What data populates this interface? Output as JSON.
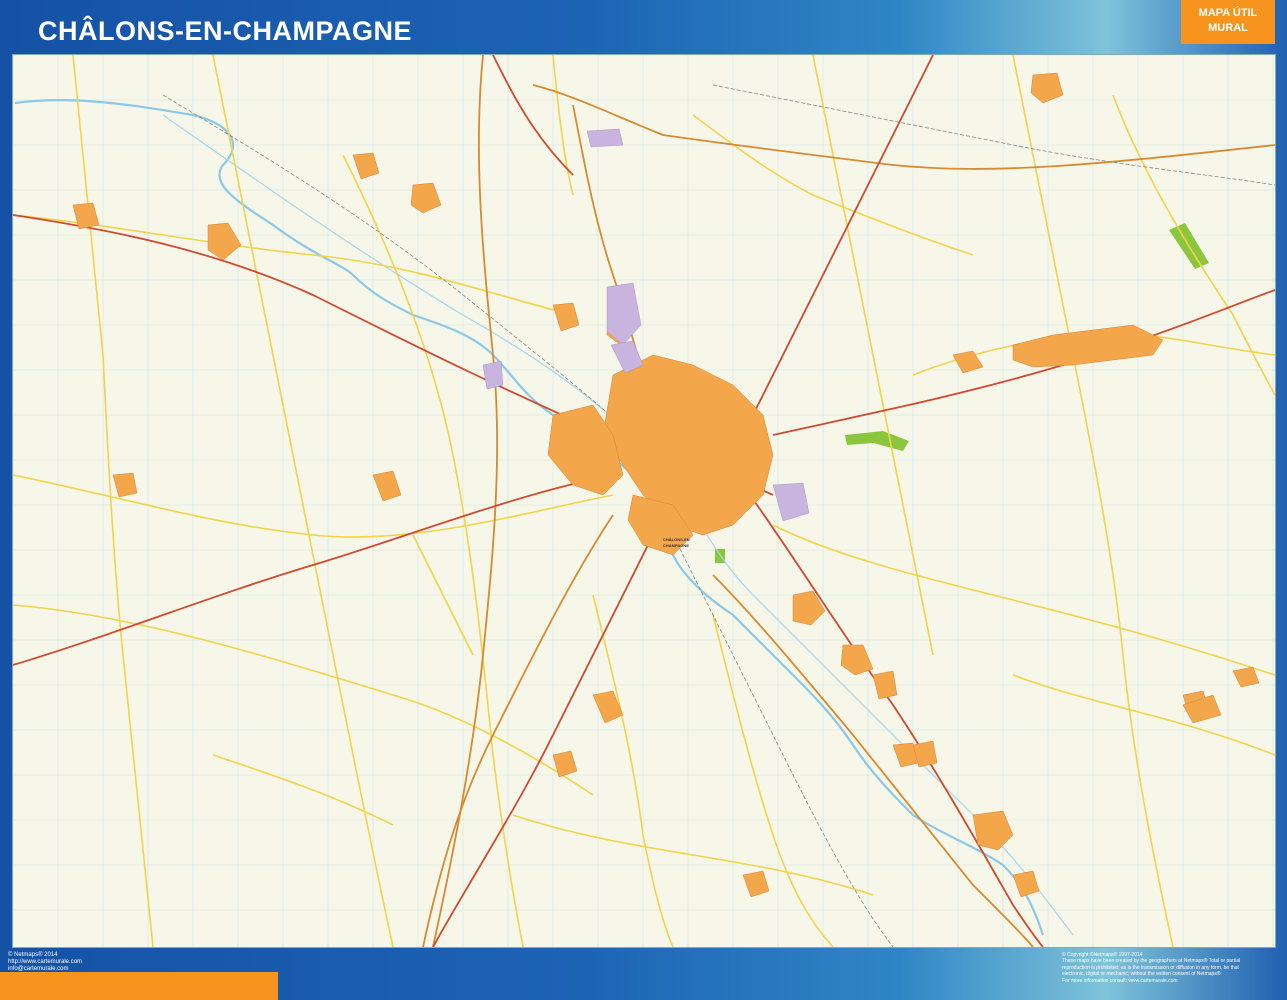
{
  "header": {
    "title": "CHÂLONS-EN-CHAMPAGNE",
    "badge_line1": "MAPA ÚTIL",
    "badge_line2": "MURAL"
  },
  "map": {
    "city_label_1": "CHÂLONS-EN",
    "city_label_2": "CHAMPAGNE",
    "colors": {
      "background": "#f6f7e8",
      "urban": "#f4a64a",
      "highway": "#d04a30",
      "main_road": "#d88a30",
      "secondary_road": "#f2d34a",
      "river": "#8cc8e8",
      "park": "#8cc63f",
      "industrial": "#c9b4e0",
      "frame_blue": "#1552a6",
      "accent_orange": "#f7941d"
    }
  },
  "footer": {
    "left_line1": "© Netmaps® 2014",
    "left_line2": "http://www.cartemurale.com",
    "left_line3": "info@cartemurale.com",
    "right_line1": "© Copyright ©Netmaps® 1997-2014",
    "right_line2": "These maps have been created by the geographers at Netmaps® Total or partial",
    "right_line3": "reproduction is prohibited; as is the transmission or diffusion in any form, be that",
    "right_line4": "electronic, digital or mechanic; without the written consent of Netmaps®",
    "right_line5": "For more information consult: www.cartemurale.com"
  }
}
